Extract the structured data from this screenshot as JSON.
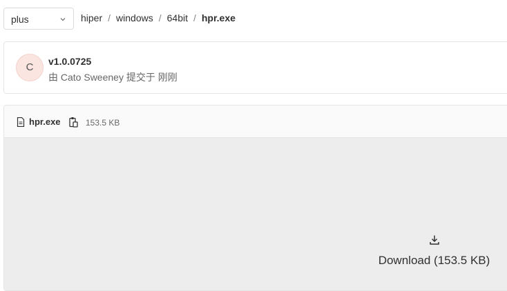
{
  "branch_selector": {
    "value": "plus",
    "icon": "chevron-down-icon"
  },
  "breadcrumb": {
    "items": [
      "hiper",
      "windows",
      "64bit"
    ],
    "current": "hpr.exe",
    "separator": "/"
  },
  "commit": {
    "avatar_letter": "C",
    "title": "v1.0.0725",
    "meta": "由 Cato Sweeney 提交于 刚刚"
  },
  "file": {
    "name": "hpr.exe",
    "size": "153.5 KB",
    "file_icon": "file-icon",
    "copy_icon": "copy-to-clipboard-icon"
  },
  "download": {
    "icon": "download-icon",
    "label": "Download (153.5 KB)"
  },
  "colors": {
    "border": "#e5e5e5",
    "body_bg": "#ededed",
    "avatar_bg": "#fbe5e1",
    "text": "#303030"
  }
}
